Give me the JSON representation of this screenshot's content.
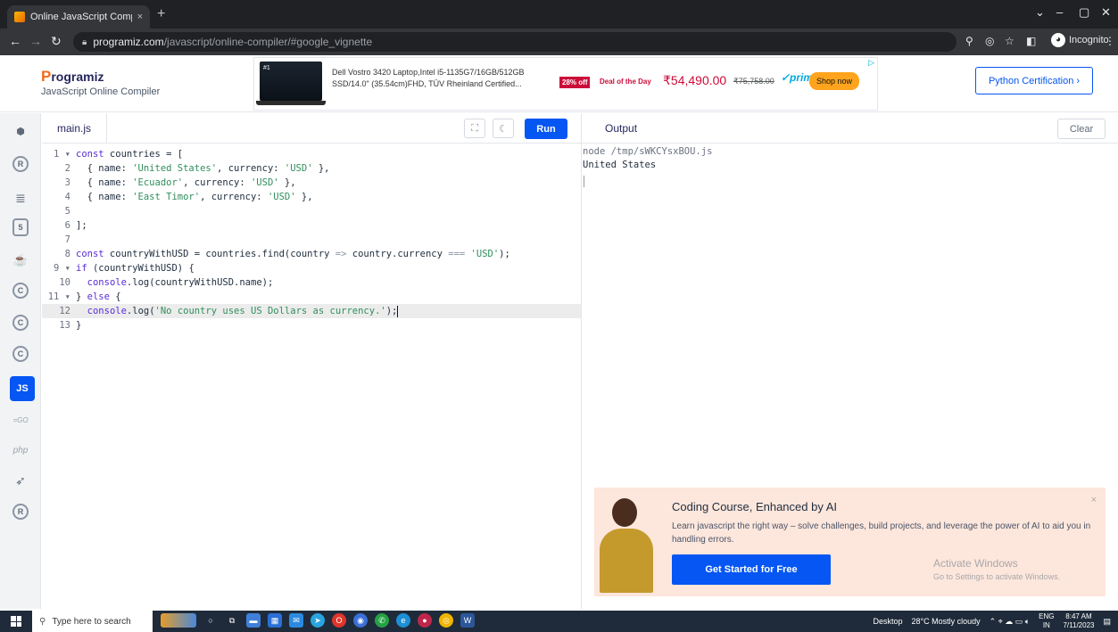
{
  "browser": {
    "tab_title": "Online JavaScript Compiler (Edit",
    "tab_close": "×",
    "new_tab": "+",
    "url_host": "programiz.com",
    "url_path": "/javascript/online-compiler/#google_vignette",
    "incognito_label": "Incognito",
    "window_controls": [
      "⌄",
      "–",
      "▢",
      "✕"
    ]
  },
  "header": {
    "logo": "rogramiz",
    "logo_initial": "P",
    "subtitle": "JavaScript Online Compiler",
    "cert_button": "Python Certification ›"
  },
  "ad": {
    "description": "Dell Vostro 3420 Laptop,Intel i5-1135G7/16GB/512GB SSD/14.0\" (35.54cm)FHD, TÜV Rheinland Certified...",
    "discount": "28% off",
    "deal": "Deal of the Day",
    "price": "₹54,490.00",
    "mrp": "₹75,758.00",
    "prime": "✓prime",
    "shop_button": "Shop now",
    "ad_marker": "▷",
    "thumb_badge": "#1"
  },
  "sidebar": {
    "items": [
      {
        "name": "python",
        "glyph": "⬢"
      },
      {
        "name": "r",
        "glyph": "R"
      },
      {
        "name": "sql",
        "glyph": "≣"
      },
      {
        "name": "html",
        "glyph": "5"
      },
      {
        "name": "java",
        "glyph": "☕"
      },
      {
        "name": "c",
        "glyph": "C"
      },
      {
        "name": "cpp",
        "glyph": "C"
      },
      {
        "name": "csharp",
        "glyph": "C"
      },
      {
        "name": "javascript",
        "glyph": "JS"
      },
      {
        "name": "go",
        "glyph": "=GO"
      },
      {
        "name": "php",
        "glyph": "php"
      },
      {
        "name": "swift",
        "glyph": "➶"
      },
      {
        "name": "rust",
        "glyph": "R"
      }
    ]
  },
  "editor": {
    "file_tab": "main.js",
    "run_button": "Run",
    "lines": [
      {
        "n": "1 ▾",
        "html": "<span class='kw'>const</span> countries = ["
      },
      {
        "n": "2",
        "html": "  { name: <span class='str'>'United States'</span>, currency: <span class='str'>'USD'</span> },"
      },
      {
        "n": "3",
        "html": "  { name: <span class='str'>'Ecuador'</span>, currency: <span class='str'>'USD'</span> },"
      },
      {
        "n": "4",
        "html": "  { name: <span class='str'>'East Timor'</span>, currency: <span class='str'>'USD'</span> },"
      },
      {
        "n": "5",
        "html": ""
      },
      {
        "n": "6",
        "html": "];"
      },
      {
        "n": "7",
        "html": ""
      },
      {
        "n": "8",
        "html": "<span class='kw'>const</span> countryWithUSD = countries.find(country <span class='op'>=&gt;</span> country.currency <span class='op'>===</span> <span class='str'>'USD'</span>);"
      },
      {
        "n": "9 ▾",
        "html": "<span class='kw'>if</span> (countryWithUSD) {"
      },
      {
        "n": "10",
        "html": "  <span class='kw'>console</span>.log(countryWithUSD.name);"
      },
      {
        "n": "11 ▾",
        "html": "} <span class='kw'>else</span> {"
      },
      {
        "n": "12",
        "html": "  <span class='kw'>console</span>.log(<span class='str'>'No country uses US Dollars as currency.'</span>);<span class='caret'></span>"
      },
      {
        "n": "13",
        "html": "}"
      }
    ],
    "current_line": 12
  },
  "output": {
    "title": "Output",
    "clear_button": "Clear",
    "lines": [
      "node /tmp/sWKCYsxBOU.js",
      "United States"
    ]
  },
  "promo": {
    "title": "Coding Course, Enhanced by AI",
    "description": "Learn javascript the right way – solve challenges, build projects, and leverage the power of AI to aid you in handling errors.",
    "cta": "Get Started for Free",
    "close": "×"
  },
  "watermark": {
    "line1": "Activate Windows",
    "line2": "Go to Settings to activate Windows."
  },
  "taskbar": {
    "search_placeholder": "Type here to search",
    "desktop_label": "Desktop",
    "weather": "28°C  Mostly cloudy",
    "lang": "ENG",
    "region": "IN",
    "time": "8:47 AM",
    "date": "7/11/2023"
  },
  "colors": {
    "accent": "#0556f3",
    "brand_orange": "#f26b1d",
    "promo_bg": "#fde6dc"
  }
}
